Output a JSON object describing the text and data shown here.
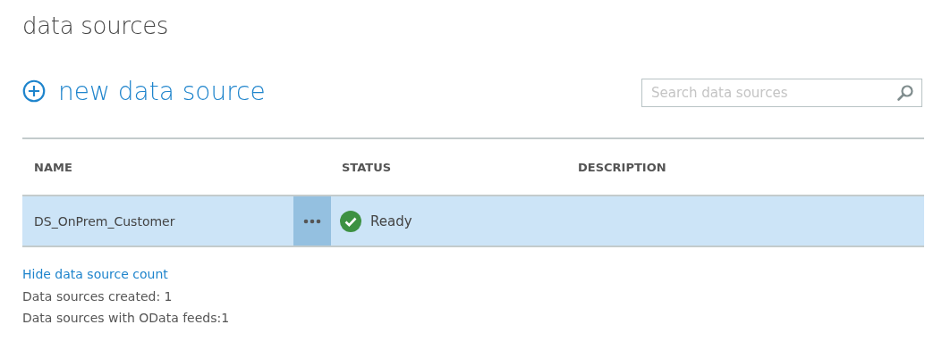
{
  "page_title": "data sources",
  "new_button": {
    "label": "new data source"
  },
  "search": {
    "placeholder": "Search data sources"
  },
  "table": {
    "columns": [
      "NAME",
      "STATUS",
      "DESCRIPTION"
    ],
    "rows": [
      {
        "name": "DS_OnPrem_Customer",
        "status": "Ready",
        "selected": true
      }
    ]
  },
  "count_link": "Hide data source count",
  "stats": [
    "Data sources created: 1",
    "Data sources with OData feeds:1"
  ]
}
